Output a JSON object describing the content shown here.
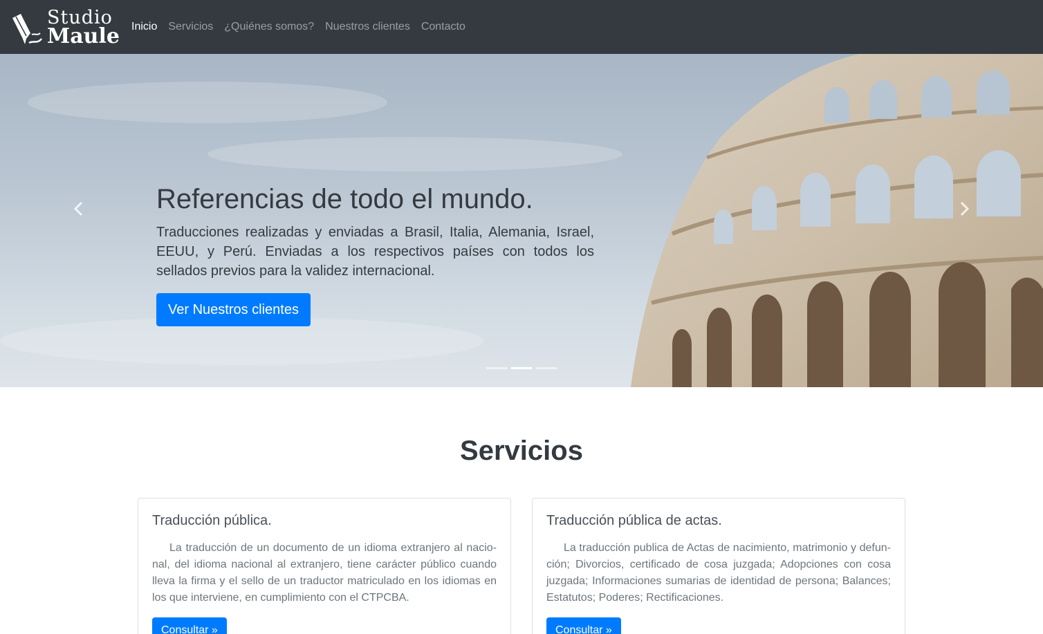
{
  "brand": {
    "line1": "Studio",
    "line2": "Maule"
  },
  "nav": {
    "items": [
      {
        "label": "Inicio",
        "active": true
      },
      {
        "label": "Servicios",
        "active": false
      },
      {
        "label": "¿Quiénes somos?",
        "active": false
      },
      {
        "label": "Nuestros clientes",
        "active": false
      },
      {
        "label": "Contacto",
        "active": false
      }
    ]
  },
  "carousel": {
    "title": "Referencias de todo el mundo.",
    "text": "Traducciones realizadas y enviadas a Brasil, Italia, Alemania, Israel, EEUU, y Perú. Enviadas a los respectivos países con todos los sellados previos para la validez internacional.",
    "button_label": "Ver Nuestros clientes",
    "slide_count": 3,
    "active_slide": 2
  },
  "services": {
    "title": "Servicios",
    "cards": [
      {
        "title": "Traducción pública.",
        "text": "La traducción de un documento de un idioma extranjero al nacio-nal, del idioma nacional al extranjero, tiene carácter público cuando lleva la firma y el sello de un traductor matriculado en los idiomas en los que interviene, en cumplimiento con el CTPCBA.",
        "button_label": "Consultar »"
      },
      {
        "title": "Traducción pública de actas.",
        "text": "La traducción publica de Actas de nacimiento, matrimonio y defun-ción; Divorcios, certificado de cosa juzgada; Adopciones con cosa juzgada; Informaciones sumarias de identidad de persona; Balances; Estatutos; Poderes; Rectificaciones.",
        "button_label": "Consultar »"
      }
    ]
  },
  "colors": {
    "navbar": "#343a40",
    "primary": "#007bff",
    "text": "#343a40"
  },
  "icons": {
    "logo": "fountain-pen-icon",
    "prev": "chevron-left-icon",
    "next": "chevron-right-icon"
  }
}
